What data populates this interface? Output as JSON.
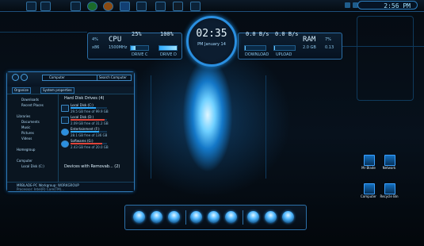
{
  "taskbar": {
    "time": "2:56 PM",
    "apps": [
      "explorer-app",
      "media-app",
      "torrent-app",
      "firefox-app",
      "photoshop-app",
      "tools-app",
      "settings-app",
      "terminal-app",
      "system-app"
    ]
  },
  "hud": {
    "cpu_label": "CPU",
    "cpu_speed": "1500MHz",
    "cpu_num": "4%",
    "cpu_core": "x86",
    "drive_c_percent": "25%",
    "drive_c_label": "DRIVE C",
    "drive_d_percent": "100%",
    "drive_d_label": "DRIVE D",
    "time": "02:35",
    "ampm": "PM",
    "date": "January 14",
    "download_rate": "0.0 B/s",
    "download_label": "DOWNLOAD",
    "upload_rate": "0.0 B/s",
    "upload_label": "UPLOAD",
    "ram_label": "RAM",
    "ram_total": "2.0 GB",
    "ram_a": "7%",
    "ram_b": "0.13",
    "ram_value": "6.5 GB",
    "ram_free": "1.9 GB",
    "meters": {
      "drive_c": 0.25,
      "drive_d": 1.0,
      "download": 0.05,
      "upload": 0.05
    }
  },
  "explorer": {
    "address": "Computer",
    "search_placeholder": "Search Computer",
    "organize": "Organize",
    "system_properties": "System properties",
    "nav": {
      "downloads": "Downloads",
      "recent": "Recent Places",
      "libraries": "Libraries",
      "documents": "Documents",
      "music": "Music",
      "pictures": "Pictures",
      "videos": "Videos",
      "homegroup": "Homegroup",
      "computer": "Computer",
      "local_disk": "Local Disk (C:)"
    },
    "section_hdd": "Hard Disk Drives (4)",
    "section_removable": "Devices with Removab... (2)",
    "drives": [
      {
        "name": "Local Disk (C:)",
        "free": "29.5 GB free of 99.9 GB",
        "usage": 0.7,
        "warn": false
      },
      {
        "name": "Local Disk (D:)",
        "free": "2.09 GB free of 31.2 GB",
        "usage": 0.93,
        "warn": true
      },
      {
        "name": "Entertainment (F:)",
        "free": "28.1 GB free of 136 GB",
        "usage": 0.79,
        "warn": false
      },
      {
        "name": "Softwares (G:)",
        "free": "2.43 GB free of 20.0 GB",
        "usage": 0.88,
        "warn": true
      }
    ],
    "status_name": "MRBLADE-PC",
    "status_workgroup": "Workgroup: WORKGROUP",
    "status_proc": "Processor: Intel(R) Core(TM)..."
  },
  "desktop_icons": [
    {
      "label": "Mr Blade"
    },
    {
      "label": "Network"
    },
    {
      "label": "Computer"
    },
    {
      "label": "Recycle Bin"
    }
  ],
  "dock": {
    "count": 10
  }
}
